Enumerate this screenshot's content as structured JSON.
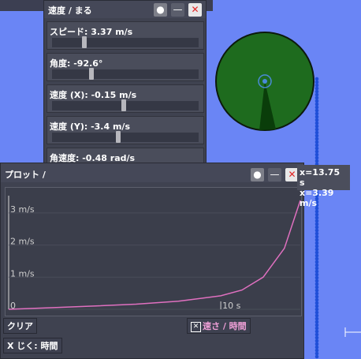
{
  "velocity_panel": {
    "title": "速度 / まる",
    "rows": [
      {
        "label": "スピード: 3.37 m/s",
        "slider_fraction": 0.22
      },
      {
        "label": "角度: -92.6°",
        "slider_fraction": 0.27
      },
      {
        "label": "速度 (X): -0.15 m/s",
        "slider_fraction": 0.49
      },
      {
        "label": "速度 (Y): -3.4 m/s",
        "slider_fraction": 0.45
      },
      {
        "label": "角速度: -0.48 rad/s",
        "slider_fraction": 0.47
      }
    ]
  },
  "plot_panel": {
    "title": "プロット /",
    "clear_button": "クリア",
    "x_axis_button": "X じく: 時間",
    "series_toggle": "速さ / 時間",
    "readout": {
      "x": "x=13.75 s",
      "y": "x=3.39 m/s"
    }
  },
  "chart_data": {
    "type": "line",
    "series": [
      {
        "name": "速さ / 時間",
        "color": "#e070c0"
      }
    ],
    "x": [
      0,
      2,
      4,
      6,
      8,
      10,
      11,
      12,
      13,
      13.75
    ],
    "y": [
      0,
      0.05,
      0.1,
      0.16,
      0.25,
      0.42,
      0.6,
      1.0,
      1.9,
      3.39
    ],
    "ytick_labels": [
      "3 m/s",
      "2 m/s",
      "1 m/s",
      "0"
    ],
    "xtick_labels": [
      "10 s"
    ],
    "yticks": [
      3,
      2,
      1,
      0
    ],
    "xticks": [
      10
    ],
    "xlim": [
      0,
      13.75
    ],
    "ylim": [
      0,
      3.39
    ]
  }
}
